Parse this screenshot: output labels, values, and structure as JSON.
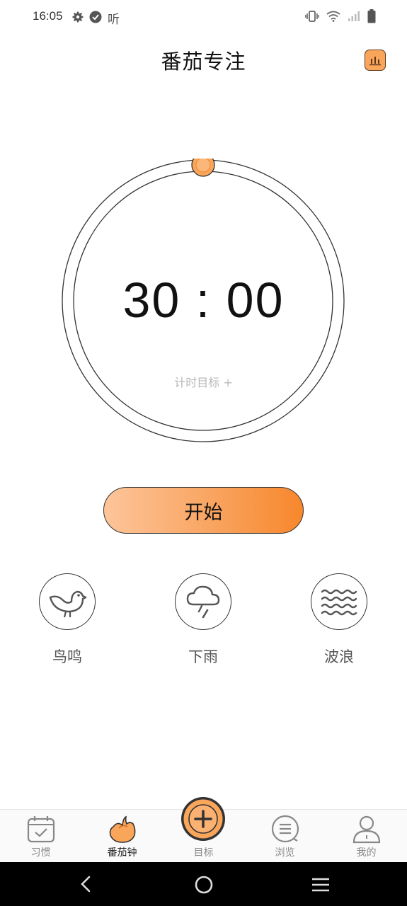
{
  "status_bar": {
    "time": "16:05",
    "extra_icon_text": "听",
    "left_icons": [
      "gear-icon",
      "check-circle-icon",
      "listen-icon"
    ],
    "right_icons": [
      "vibrate-icon",
      "wifi-icon",
      "signal-icon",
      "battery-icon"
    ]
  },
  "header": {
    "title": "番茄专注",
    "stats_icon": "bar-chart-icon"
  },
  "timer": {
    "display": "30 : 00",
    "goal_label": "计时目标 +",
    "progress": 0
  },
  "start_button": {
    "label": "开始"
  },
  "sounds": [
    {
      "label": "鸟鸣",
      "icon": "bird-icon"
    },
    {
      "label": "下雨",
      "icon": "rain-icon"
    },
    {
      "label": "波浪",
      "icon": "waves-icon"
    }
  ],
  "bottom_nav": [
    {
      "label": "习惯",
      "icon": "calendar-check-icon",
      "active": false
    },
    {
      "label": "番茄钟",
      "icon": "tomato-icon",
      "active": true
    },
    {
      "label": "目标",
      "icon": "add-circle-icon",
      "active": false
    },
    {
      "label": "浏览",
      "icon": "list-circle-icon",
      "active": false
    },
    {
      "label": "我的",
      "icon": "user-icon",
      "active": false
    }
  ],
  "colors": {
    "accent": "#f9a55a",
    "accent_dark": "#f7872c",
    "accent_light": "#fdc59a"
  },
  "system_nav": [
    "back-icon",
    "home-icon",
    "recents-icon"
  ]
}
